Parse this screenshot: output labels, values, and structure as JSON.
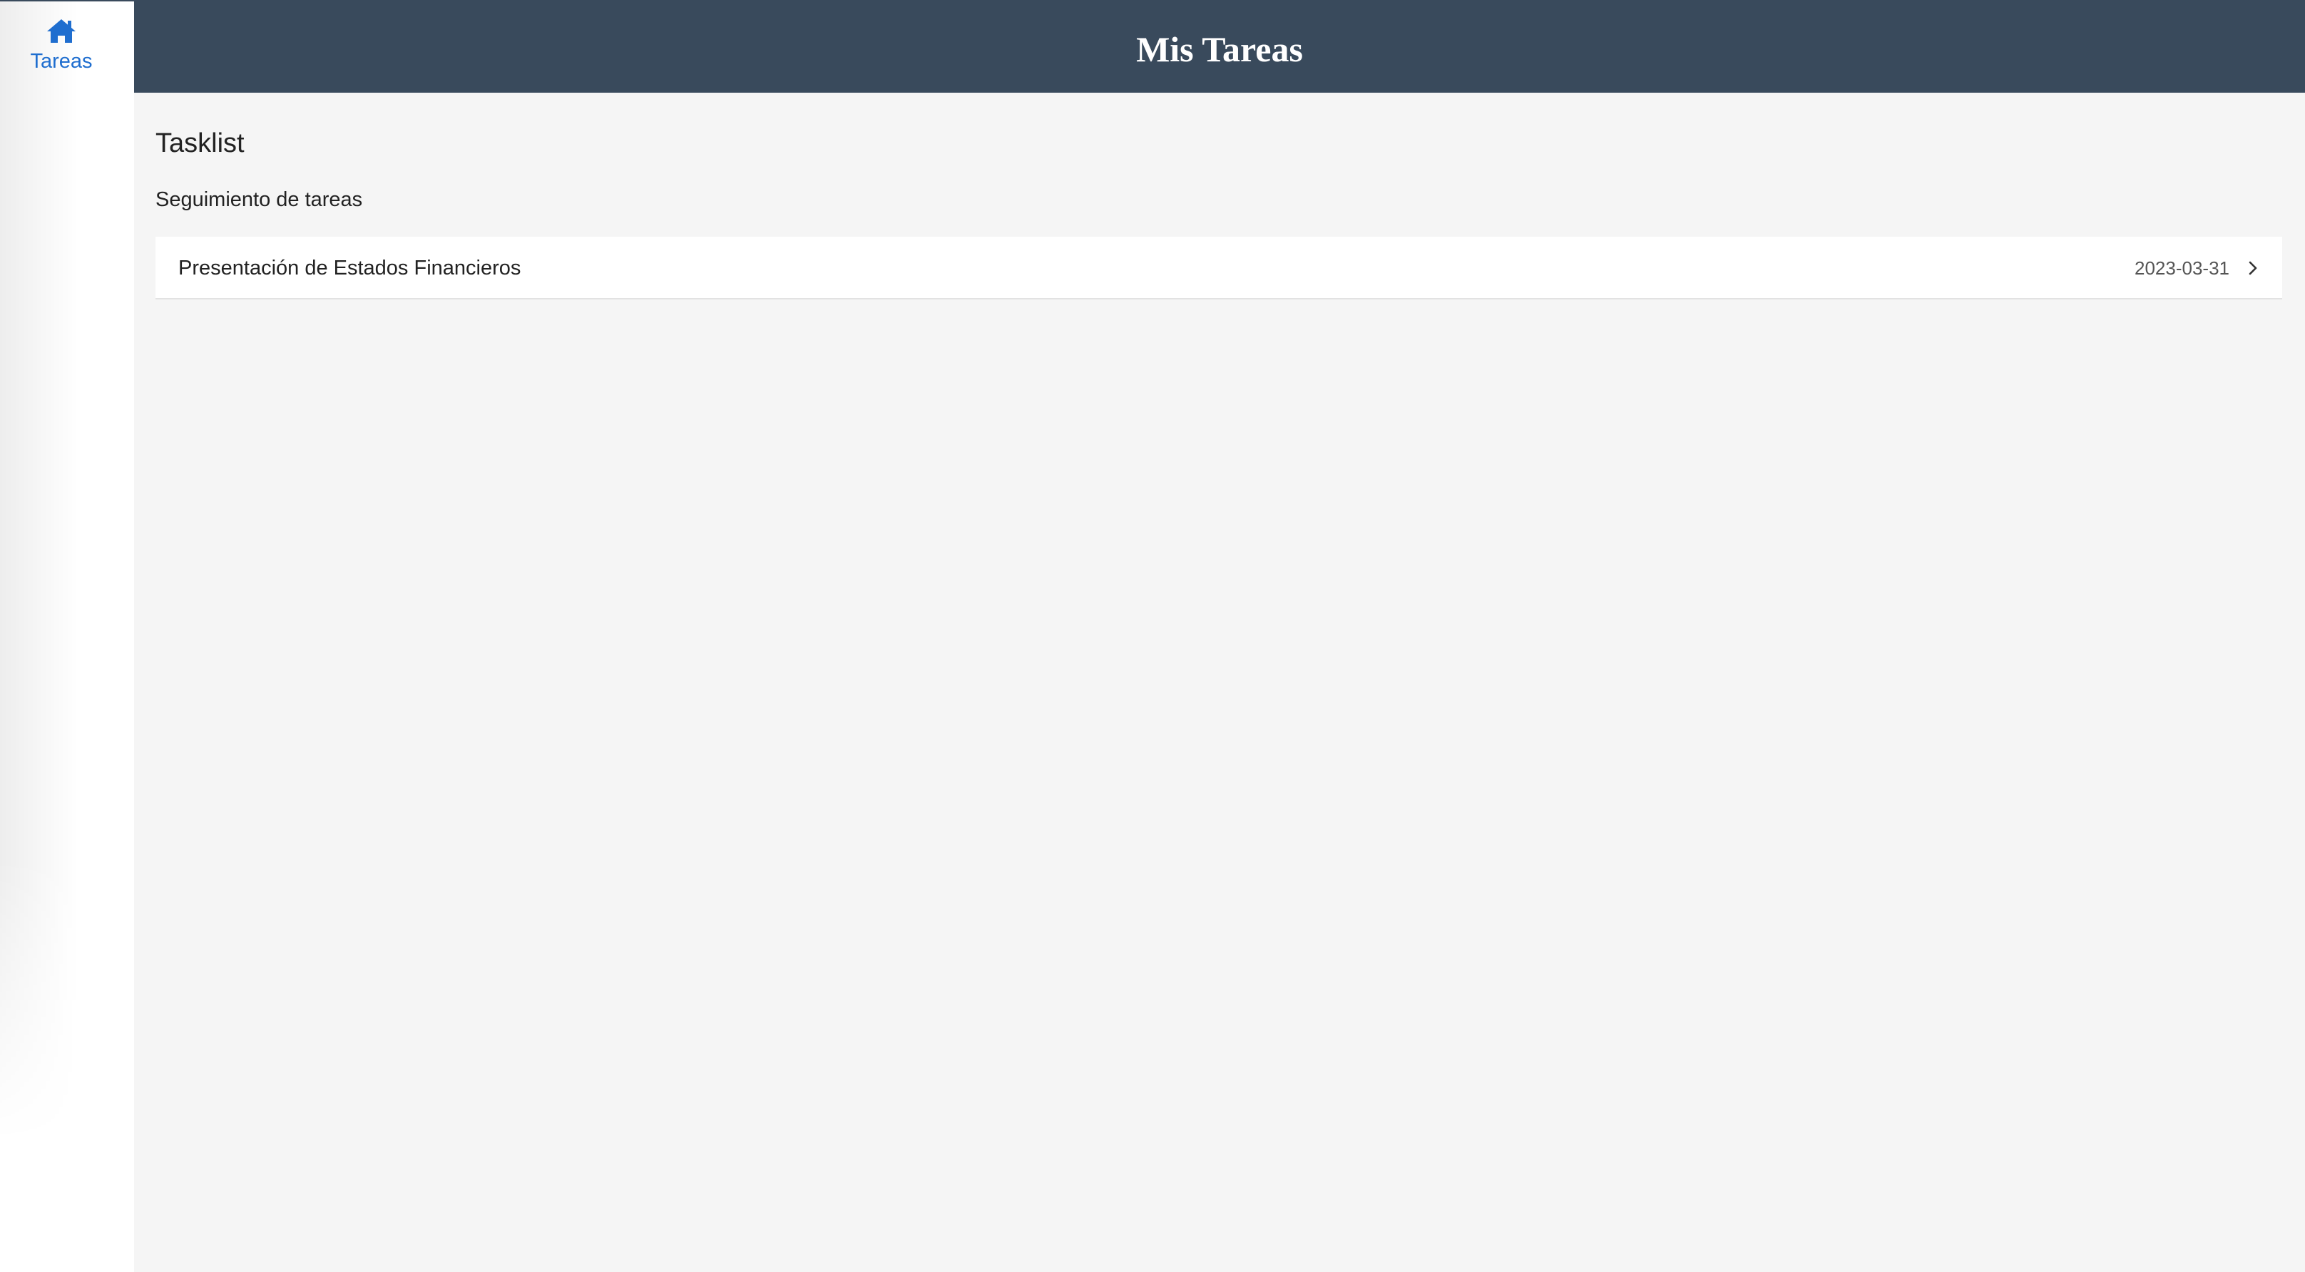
{
  "sidebar": {
    "items": [
      {
        "label": "Tareas",
        "icon": "home-icon",
        "active": true
      }
    ],
    "accent_color": "#1f6ecf"
  },
  "header": {
    "title": "Mis Tareas",
    "background_color": "#394a5c"
  },
  "main": {
    "title": "Tasklist",
    "subtitle": "Seguimiento de tareas",
    "tasks": [
      {
        "name": "Presentación de Estados Financieros",
        "date": "2023-03-31",
        "icon": "chevron-right-icon"
      }
    ]
  }
}
